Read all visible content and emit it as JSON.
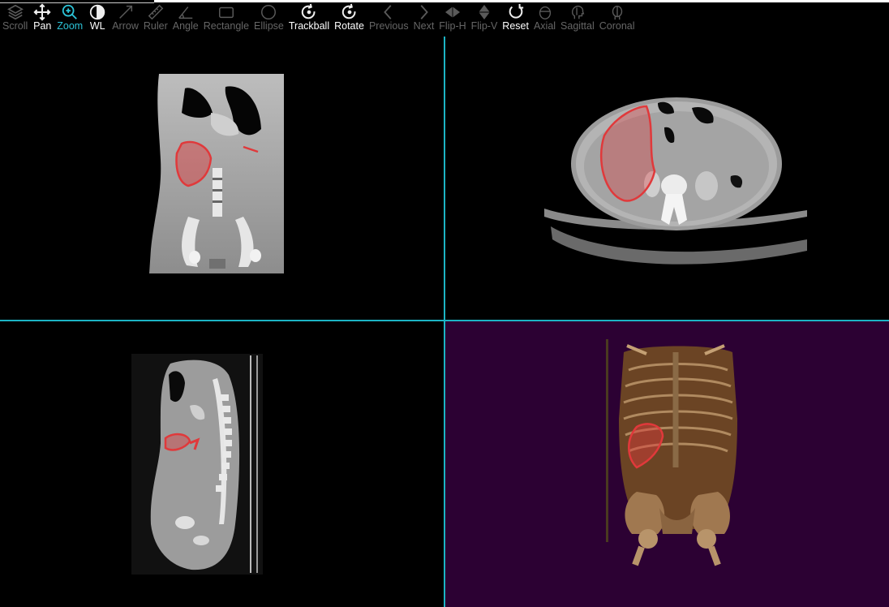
{
  "toolbar": {
    "tools": [
      {
        "label": "Scroll",
        "icon": "layers-icon",
        "state": "disabled"
      },
      {
        "label": "Pan",
        "icon": "move-arrows-icon",
        "state": "enabled"
      },
      {
        "label": "Zoom",
        "icon": "zoom-in-icon",
        "state": "active"
      },
      {
        "label": "WL",
        "icon": "contrast-icon",
        "state": "enabled"
      },
      {
        "label": "Arrow",
        "icon": "arrow-icon",
        "state": "disabled"
      },
      {
        "label": "Ruler",
        "icon": "ruler-icon",
        "state": "disabled"
      },
      {
        "label": "Angle",
        "icon": "angle-icon",
        "state": "disabled"
      },
      {
        "label": "Rectangle",
        "icon": "rectangle-icon",
        "state": "disabled"
      },
      {
        "label": "Ellipse",
        "icon": "ellipse-icon",
        "state": "disabled"
      },
      {
        "label": "Trackball",
        "icon": "rotate-trackball-icon",
        "state": "enabled"
      },
      {
        "label": "Rotate",
        "icon": "rotate-icon",
        "state": "enabled"
      },
      {
        "label": "Previous",
        "icon": "chevron-left-icon",
        "state": "disabled"
      },
      {
        "label": "Next",
        "icon": "chevron-right-icon",
        "state": "disabled"
      },
      {
        "label": "Flip-H",
        "icon": "flip-horizontal-icon",
        "state": "disabled"
      },
      {
        "label": "Flip-V",
        "icon": "flip-vertical-icon",
        "state": "disabled"
      },
      {
        "label": "Reset",
        "icon": "reset-icon",
        "state": "enabled"
      },
      {
        "label": "Axial",
        "icon": "head-axial-icon",
        "state": "disabled"
      },
      {
        "label": "Sagittal",
        "icon": "head-sagittal-icon",
        "state": "disabled"
      },
      {
        "label": "Coronal",
        "icon": "head-coronal-icon",
        "state": "disabled"
      }
    ]
  },
  "viewports": {
    "coronal": {
      "view": "coronal-ct",
      "segmentation_color": "#e0393b"
    },
    "axial": {
      "view": "axial-ct",
      "segmentation_color": "#e0393b"
    },
    "sagittal": {
      "view": "sagittal-ct",
      "segmentation_color": "#e0393b"
    },
    "render3d": {
      "view": "volume-render",
      "background": "#2c0133",
      "segmentation_color": "#e0393b"
    }
  },
  "colors": {
    "accent": "#2cc4d8",
    "divider": "#1cb4c4",
    "enabled_text": "#ffffff",
    "disabled_text": "#666666",
    "segmentation": "#e0393b"
  }
}
